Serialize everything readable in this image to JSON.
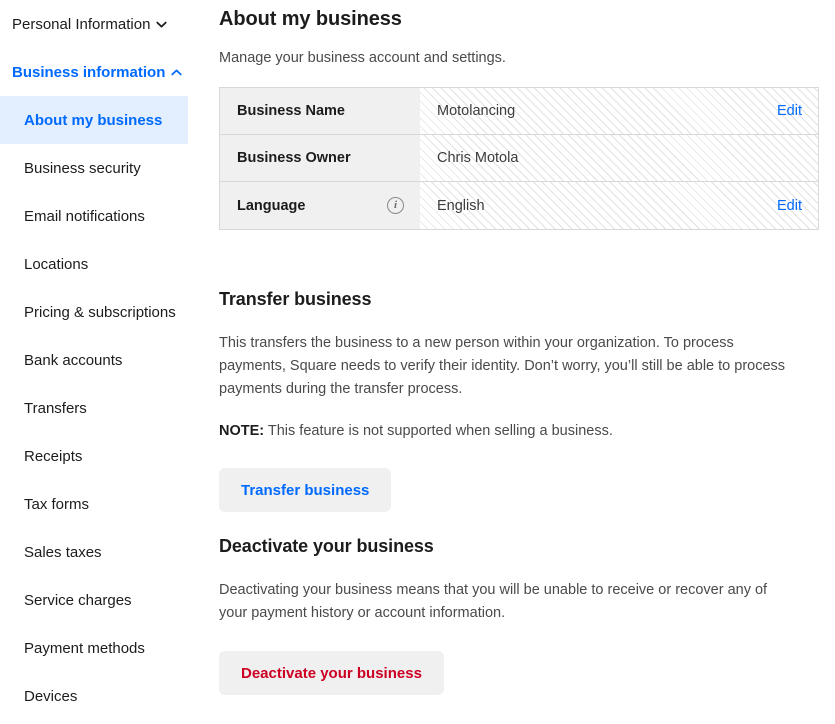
{
  "sidebar": {
    "groups": [
      {
        "label": "Personal Information",
        "icon": "chevron-down-icon",
        "expanded": false,
        "active": false
      },
      {
        "label": "Business information",
        "icon": "chevron-up-icon",
        "expanded": true,
        "active": true
      }
    ],
    "items": [
      {
        "label": "About my business",
        "selected": true
      },
      {
        "label": "Business security",
        "selected": false
      },
      {
        "label": "Email notifications",
        "selected": false
      },
      {
        "label": "Locations",
        "selected": false
      },
      {
        "label": "Pricing & subscriptions",
        "selected": false
      },
      {
        "label": "Bank accounts",
        "selected": false
      },
      {
        "label": "Transfers",
        "selected": false
      },
      {
        "label": "Receipts",
        "selected": false
      },
      {
        "label": "Tax forms",
        "selected": false
      },
      {
        "label": "Sales taxes",
        "selected": false
      },
      {
        "label": "Service charges",
        "selected": false
      },
      {
        "label": "Payment methods",
        "selected": false
      },
      {
        "label": "Devices",
        "selected": false
      }
    ]
  },
  "main": {
    "title": "About my business",
    "subtitle": "Manage your business account and settings.",
    "table": {
      "rows": [
        {
          "label": "Business Name",
          "value": "Motolancing",
          "edit_label": "Edit",
          "has_edit": true,
          "has_info": false
        },
        {
          "label": "Business Owner",
          "value": "Chris Motola",
          "edit_label": "",
          "has_edit": false,
          "has_info": false
        },
        {
          "label": "Language",
          "value": "English",
          "edit_label": "Edit",
          "has_edit": true,
          "has_info": true,
          "info_icon": "info-circle-icon"
        }
      ]
    },
    "transfer": {
      "title": "Transfer business",
      "body": "This transfers the business to a new person within your organization. To process payments, Square needs to verify their identity. Don’t worry, you’ll still be able to process payments during the transfer process.",
      "note_prefix": "NOTE:",
      "note_body": "This feature is not supported when selling a business.",
      "button_label": "Transfer business"
    },
    "deactivate": {
      "title": "Deactivate your business",
      "body": "Deactivating your business means that you will be unable to receive or recover any of your payment history or account information.",
      "button_label": "Deactivate your business"
    }
  },
  "colors": {
    "accent_blue": "#006aff",
    "danger_red": "#cc0023",
    "selected_bg": "#e3eeff",
    "label_bg": "#f0f0f0",
    "button_bg": "#f0f0f0"
  }
}
